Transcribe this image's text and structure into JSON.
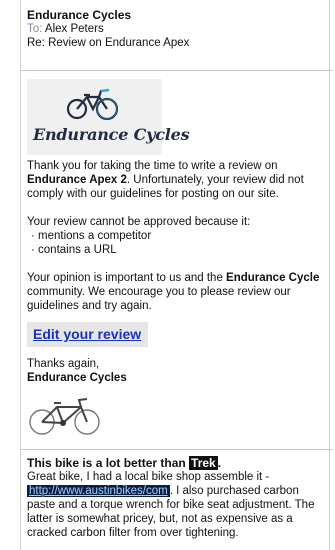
{
  "email": {
    "from": "Endurance Cycles",
    "to_label": "To:",
    "to_name": "Alex Peters",
    "subject": "Re: Review on Endurance Apex"
  },
  "logo": {
    "text": "Endurance Cycles",
    "accent_color": "#29b6d8"
  },
  "body": {
    "p1_a": "Thank you for taking the time to write a review on ",
    "p1_product": "Endurance Apex 2",
    "p1_b": ". Unfortunately, your review did not comply with our guidelines for posting on our site.",
    "reasons_intro": "Your review cannot be approved because it:",
    "reasons": [
      "· mentions a competitor",
      "· contains a URL"
    ],
    "p3_a": "Your opinion is important to us and the ",
    "p3_brand": "Endurance Cycle",
    "p3_b": " community. We encourage you to please review our guidelines and try again.",
    "edit_link": "Edit your review",
    "thanks": "Thanks again,",
    "signature": "Endurance Cycles"
  },
  "review": {
    "title_a": "This bike is a lot better than ",
    "title_competitor": "Trek",
    "title_b": ".",
    "text_a": "Great bike, I had a local bike shop assemble it -",
    "url": "http://www.austinbikes/com",
    "text_b": ". I also purchased carbon paste and a torque wrench for bike seat adjustment. The latter is somewhat pricey, but, not as expensive as a cracked carbon filter from over tightening."
  }
}
